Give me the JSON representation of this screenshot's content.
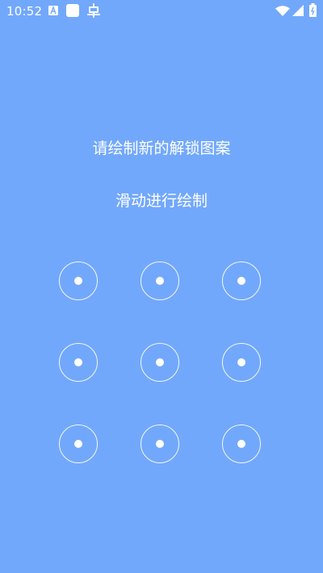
{
  "status_bar": {
    "time": "10:52",
    "notification_icons": [
      "font-a-icon",
      "square-app-icon",
      "bug-icon"
    ],
    "system_icons": [
      "wifi-icon",
      "signal-icon",
      "battery-icon"
    ]
  },
  "lock_setup": {
    "title": "请绘制新的解锁图案",
    "subtitle": "滑动进行绘制",
    "pattern": {
      "rows": 3,
      "cols": 3,
      "nodes": [
        "1",
        "2",
        "3",
        "4",
        "5",
        "6",
        "7",
        "8",
        "9"
      ]
    }
  },
  "colors": {
    "background": "#72a8fb",
    "foreground": "#ffffff"
  }
}
